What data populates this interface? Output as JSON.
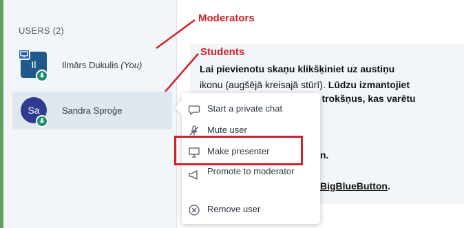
{
  "sidebar": {
    "users_header": "USERS (2)",
    "users": [
      {
        "initials": "Il",
        "name": "Ilmārs Dukulis",
        "suffix": "(You)",
        "role": "moderator"
      },
      {
        "initials": "Sa",
        "name": "Sandra Sproģe",
        "suffix": "",
        "role": "student"
      }
    ]
  },
  "annotations": {
    "moderators": "Moderators",
    "students": "Students",
    "color": "#d0202a"
  },
  "content": {
    "line1": "Lai pievienotu skaņu klikšķiniet uz austiņu",
    "line2_normal": "ikonu (augšējā kreisajā stūrī). ",
    "line2_bold": "Lūdzu izmantojiet",
    "line3_bold": "u trokšņus, kas varētu",
    "line4": "n.",
    "line5": "BigBlueButton",
    "line5_tail": "."
  },
  "context_menu": {
    "items": [
      {
        "label": "Start a private chat",
        "icon": "chat-icon"
      },
      {
        "label": "Mute user",
        "icon": "mic-off-icon"
      },
      {
        "label": "Make presenter",
        "icon": "presentation-icon"
      },
      {
        "label": "Promote to moderator",
        "icon": "promote-icon"
      },
      {
        "label": "Remove user",
        "icon": "remove-icon"
      }
    ]
  },
  "colors": {
    "accent_green": "#5fa35f",
    "avatar_moderator": "#1f5a8c",
    "avatar_student": "#2f3b8f",
    "mic_badge": "#1a8d6d",
    "highlight": "#d0202a"
  }
}
